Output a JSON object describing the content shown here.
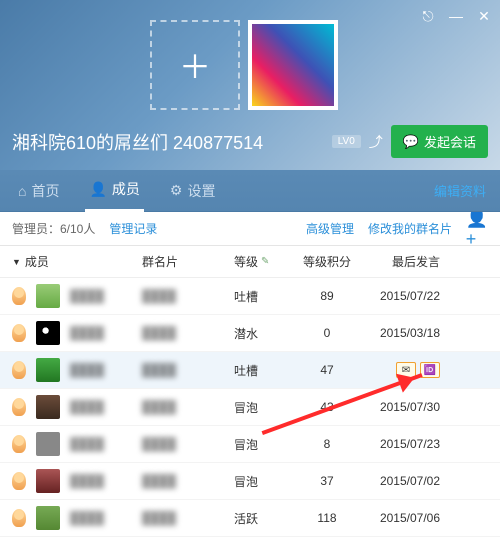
{
  "window": {
    "pin": "⎋",
    "min": "—",
    "close": "✕"
  },
  "header": {
    "add_placeholder": "＋",
    "group_title": "湘科院610的屌丝们 240877514",
    "level": "LV0",
    "share_icon": "⤴",
    "start_chat": "发起会话",
    "chat_icon": "💬"
  },
  "tabs": {
    "home": "首页",
    "members": "成员",
    "settings": "设置",
    "edit": "编辑资料",
    "home_icon": "⌂",
    "members_icon": "👤",
    "settings_icon": "⚙"
  },
  "subbar": {
    "admin_label": "管理员：6/10人",
    "manage_log": "管理记录",
    "adv_manage": "高级管理",
    "edit_card": "修改我的群名片",
    "add_user": "👤+"
  },
  "columns": {
    "member": "成员",
    "card": "群名片",
    "level": "等级",
    "points": "等级积分",
    "last": "最后发言"
  },
  "rows": [
    {
      "pic": "p1",
      "level": "吐槽",
      "points": "89",
      "last": "2015/07/22"
    },
    {
      "pic": "p2",
      "level": "潜水",
      "points": "0",
      "last": "2015/03/18"
    },
    {
      "pic": "p3",
      "level": "吐槽",
      "points": "47",
      "last": "",
      "hover": true
    },
    {
      "pic": "p4",
      "level": "冒泡",
      "points": "43",
      "last": "2015/07/30"
    },
    {
      "pic": "p5",
      "level": "冒泡",
      "points": "8",
      "last": "2015/07/23"
    },
    {
      "pic": "p6",
      "level": "冒泡",
      "points": "37",
      "last": "2015/07/02"
    },
    {
      "pic": "p7",
      "level": "活跃",
      "points": "118",
      "last": "2015/07/06"
    }
  ],
  "action_icons": {
    "msg": "✉",
    "card": "🆔"
  }
}
